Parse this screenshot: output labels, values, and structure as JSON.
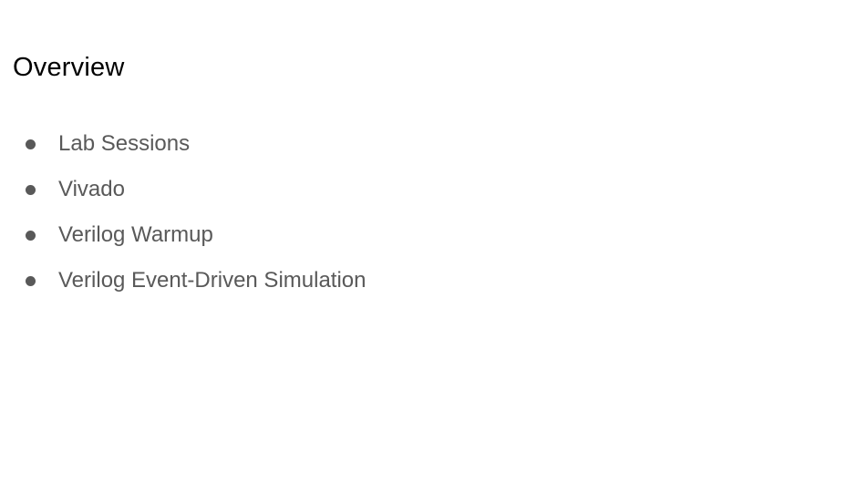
{
  "slide": {
    "title": "Overview",
    "bullets": [
      {
        "label": "Lab Sessions"
      },
      {
        "label": "Vivado"
      },
      {
        "label": "Verilog Warmup"
      },
      {
        "label": "Verilog Event-Driven Simulation"
      }
    ]
  },
  "colors": {
    "background": "#ffffff",
    "title": "#000000",
    "body_text": "#595959"
  }
}
